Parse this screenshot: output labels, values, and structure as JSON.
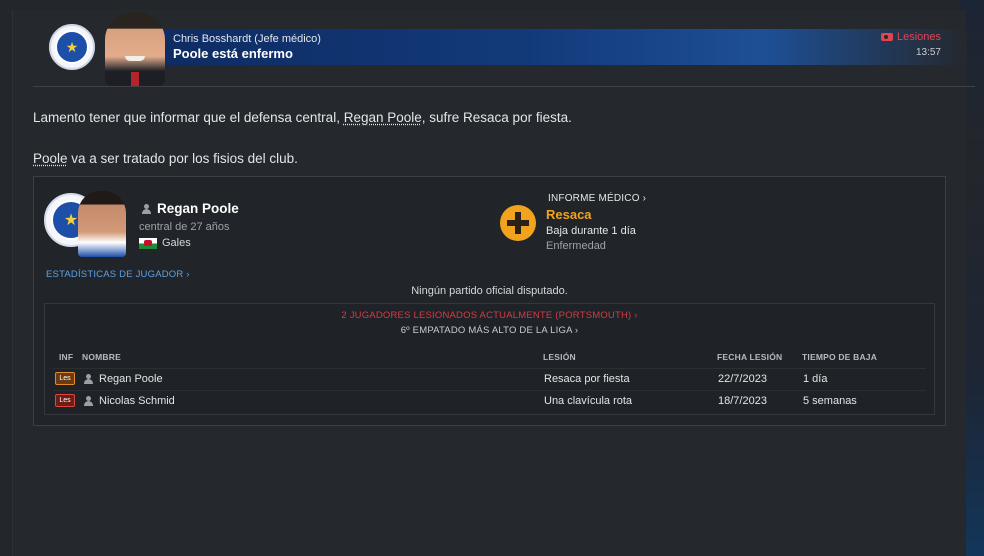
{
  "header": {
    "sender": "Chris Bosshardt  (Jefe médico)",
    "subject": "Poole está enfermo",
    "category": "Lesiones",
    "time": "13:57",
    "colors": {
      "banner": "#123a7a",
      "category": "#e2454f"
    }
  },
  "body": {
    "para1_pre": "Lamento tener que informar que el defensa central, ",
    "para1_link": "Regan Poole",
    "para1_post": ", sufre Resaca por fiesta.",
    "para2_link": "Poole",
    "para2_post": " va a ser tratado por los fisios del club."
  },
  "player": {
    "name": "Regan Poole",
    "description": "central de 27 años",
    "nation": "Gales",
    "stats_link": "ESTADÍSTICAS DE JUGADOR ›"
  },
  "medical": {
    "report_link": "INFORME MÉDICO ›",
    "injury": "Resaca",
    "duration": "Baja durante 1 día",
    "type": "Enfermedad",
    "icon": "medical-cross-icon",
    "accent": "#f2a31d"
  },
  "no_matches": "Ningún partido oficial disputado.",
  "squad": {
    "injured_count": "2 JUGADORES LESIONADOS ACTUALMENTE (PORTSMOUTH) ›",
    "league_rank": "6º EMPATADO MÁS ALTO DE LA LIGA ›",
    "columns": {
      "inf": "INF",
      "name": "NOMBRE",
      "injury": "LESIÓN",
      "date": "FECHA LESIÓN",
      "time_out": "TIEMPO DE BAJA"
    },
    "rows": [
      {
        "badge": "Les",
        "name": "Regan Poole",
        "injury": "Resaca por fiesta",
        "date": "22/7/2023",
        "time_out": "1 día"
      },
      {
        "badge": "Les",
        "name": "Nicolas Schmid",
        "injury": "Una clavícula rota",
        "date": "18/7/2023",
        "time_out": "5 semanas"
      }
    ]
  }
}
